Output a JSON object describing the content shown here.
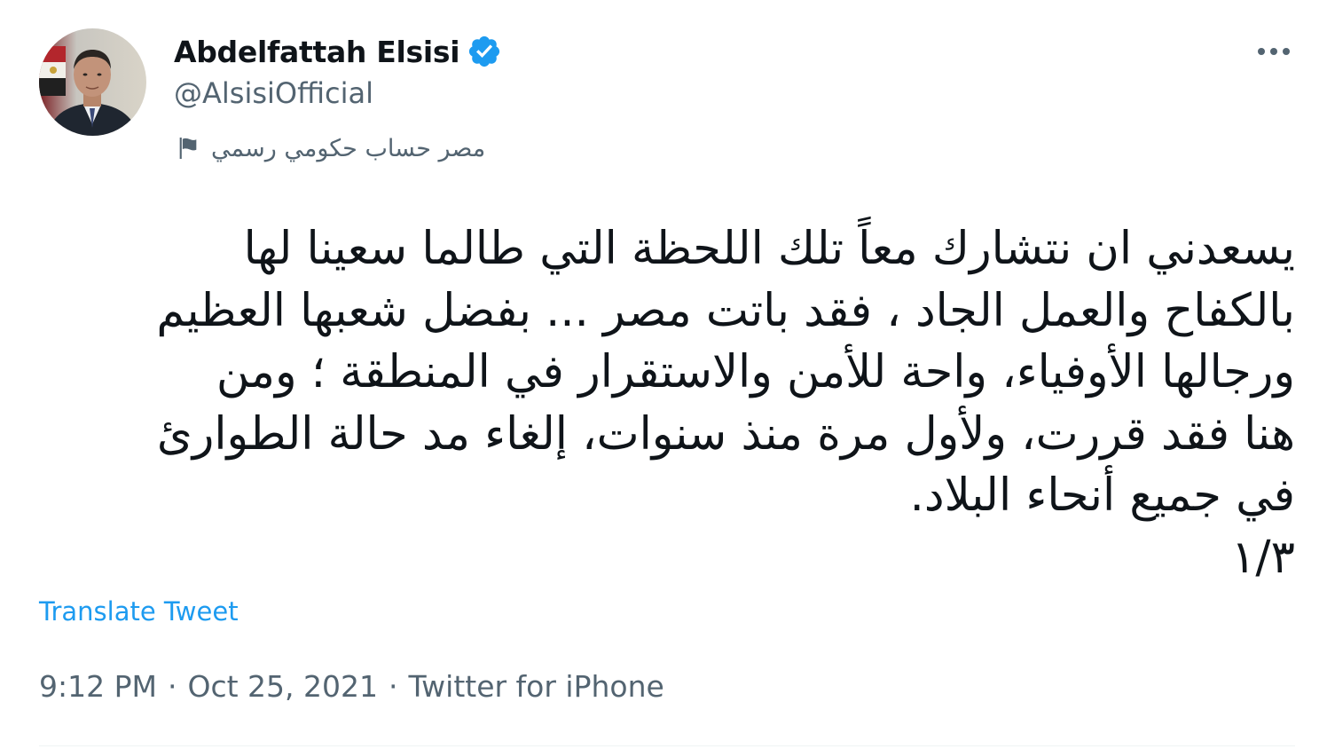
{
  "author": {
    "display_name": "Abdelfattah Elsisi",
    "handle": "@AlsisiOfficial",
    "verified": true,
    "government_label": "مصر حساب حكومي رسمي"
  },
  "avatar": {
    "icon": "profile-photo"
  },
  "tweet": {
    "text_lines": [
      "يسعدني ان نتشارك معاً تلك اللحظة التي طالما سعينا لها",
      "بالكفاح والعمل الجاد ، فقد باتت مصر ... بفضل شعبها العظيم",
      "ورجالها الأوفياء، واحة للأمن والاستقرار في المنطقة ؛ ومن",
      "هنا فقد قررت، ولأول مرة منذ سنوات، إلغاء مد حالة الطوارئ",
      "في جميع أنحاء البلاد.",
      "١/٣"
    ],
    "translate_label": "Translate Tweet",
    "time": "9:12 PM",
    "date": "Oct 25, 2021",
    "separator": "·",
    "source": "Twitter for iPhone"
  },
  "icons": {
    "verified": "verified-badge-icon",
    "flag": "flag-icon",
    "more": "more-options-icon"
  },
  "colors": {
    "verified_blue": "#1d9bf0",
    "link_blue": "#1d9bf0",
    "secondary_text": "#536471",
    "primary_text": "#0f1419"
  }
}
